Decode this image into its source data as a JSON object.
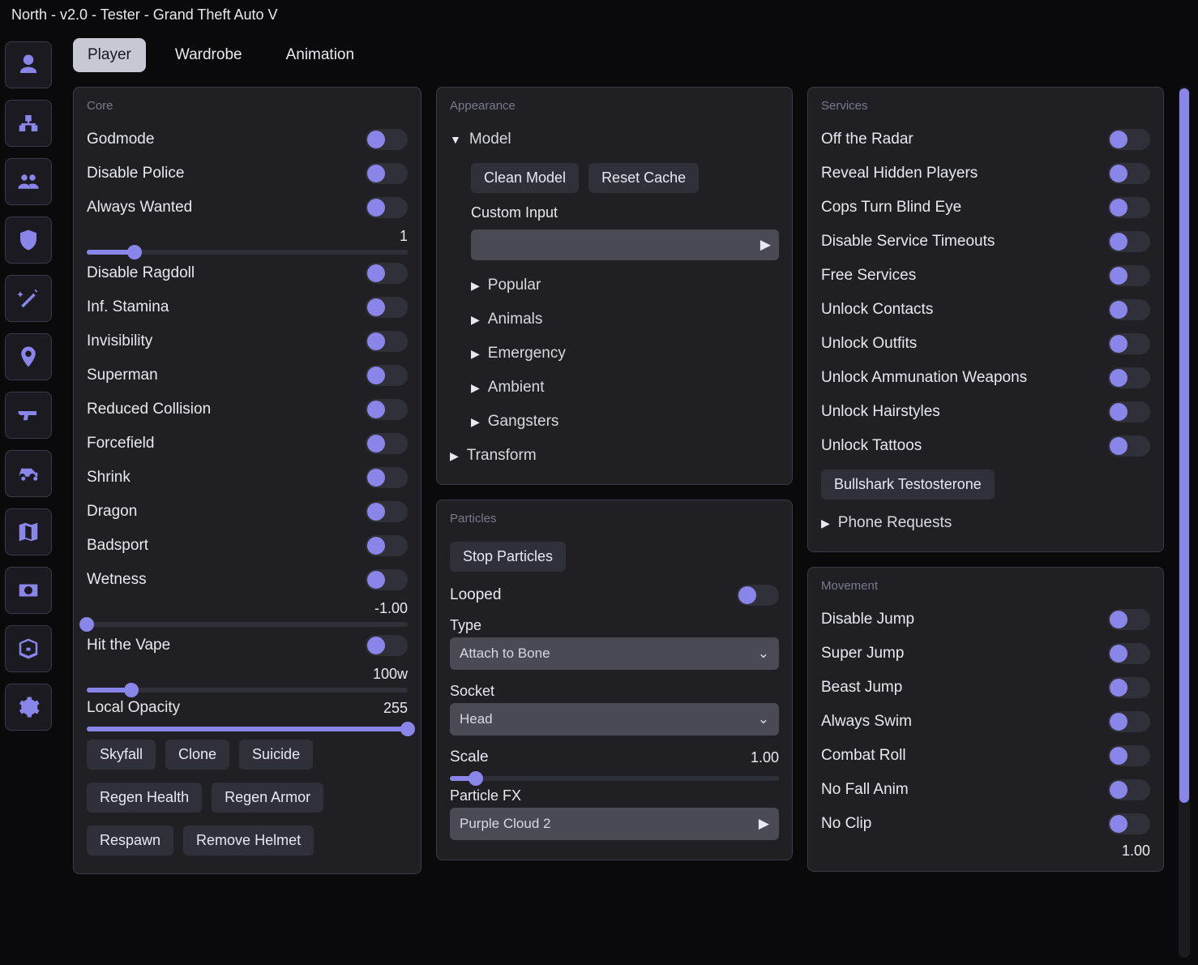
{
  "title": "North - v2.0 - Tester - Grand Theft Auto V",
  "sidebar_icons": [
    "user",
    "network",
    "group",
    "shield",
    "wand",
    "pin",
    "gun",
    "car",
    "map",
    "money",
    "box",
    "gear"
  ],
  "tabs": {
    "items": [
      "Player",
      "Wardrobe",
      "Animation"
    ],
    "active": 0
  },
  "core": {
    "title": "Core",
    "toggles": [
      "Godmode",
      "Disable Police",
      "Always Wanted"
    ],
    "wanted_value": "1",
    "wanted_fill": 15,
    "toggles2": [
      "Disable Ragdoll",
      "Inf. Stamina",
      "Invisibility",
      "Superman",
      "Reduced Collision",
      "Forcefield",
      "Shrink",
      "Dragon",
      "Badsport"
    ],
    "wetness_label": "Wetness",
    "wetness_value": "-1.00",
    "wetness_fill": 0,
    "vape_label": "Hit the Vape",
    "vape_value": "100w",
    "vape_fill": 14,
    "opacity_label": "Local Opacity",
    "opacity_value": "255",
    "opacity_fill": 100,
    "buttons": [
      "Skyfall",
      "Clone",
      "Suicide",
      "Regen Health",
      "Regen Armor",
      "Respawn",
      "Remove Helmet"
    ]
  },
  "appearance": {
    "title": "Appearance",
    "model_label": "Model",
    "clean": "Clean Model",
    "reset": "Reset Cache",
    "custom_input_label": "Custom Input",
    "subtrees": [
      "Popular",
      "Animals",
      "Emergency",
      "Ambient",
      "Gangsters"
    ],
    "transform_label": "Transform"
  },
  "particles": {
    "title": "Particles",
    "stop": "Stop Particles",
    "looped_label": "Looped",
    "type_label": "Type",
    "type_value": "Attach to Bone",
    "socket_label": "Socket",
    "socket_value": "Head",
    "scale_label": "Scale",
    "scale_value": "1.00",
    "scale_fill": 8,
    "fx_label": "Particle FX",
    "fx_value": "Purple Cloud 2"
  },
  "services": {
    "title": "Services",
    "toggles": [
      "Off the Radar",
      "Reveal Hidden Players",
      "Cops Turn Blind Eye",
      "Disable Service Timeouts",
      "Free Services",
      "Unlock Contacts",
      "Unlock Outfits",
      "Unlock Ammunation Weapons",
      "Unlock Hairstyles",
      "Unlock Tattoos"
    ],
    "bullshark": "Bullshark Testosterone",
    "phone_label": "Phone Requests"
  },
  "movement": {
    "title": "Movement",
    "toggles": [
      "Disable Jump",
      "Super Jump",
      "Beast Jump",
      "Always Swim",
      "Combat Roll",
      "No Fall Anim",
      "No Clip"
    ],
    "noclip_value": "1.00"
  }
}
